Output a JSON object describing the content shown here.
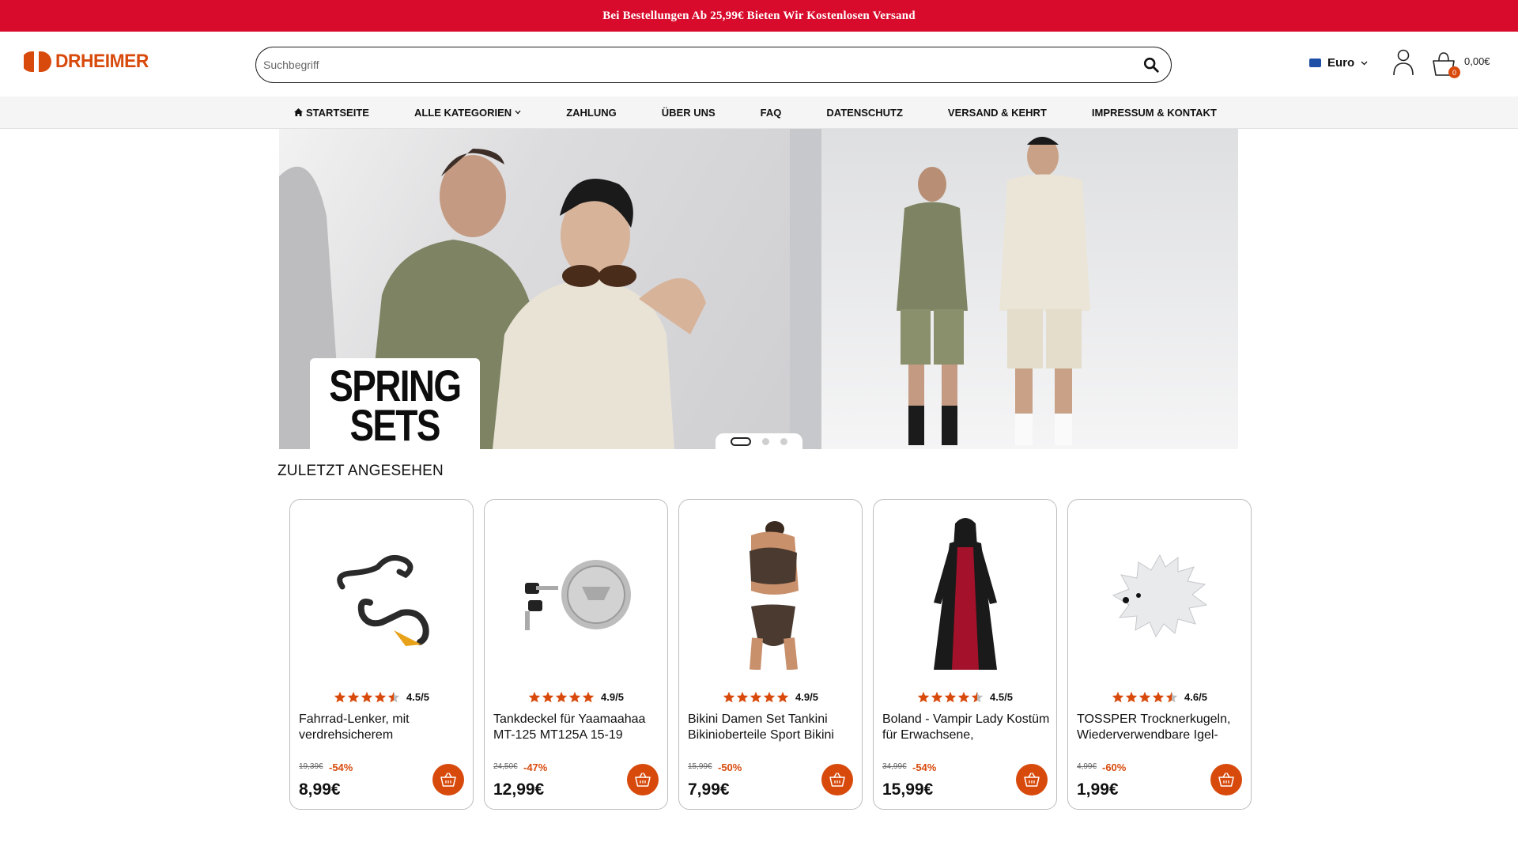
{
  "promo": {
    "text": "Bei Bestellungen Ab 25,99€ Bieten Wir Kostenlosen Versand"
  },
  "header": {
    "logo_text": "DRHEIMER",
    "search_placeholder": "Suchbegriff",
    "currency": "Euro",
    "cart_count": "0",
    "cart_total": "0,00€"
  },
  "nav": {
    "items": [
      {
        "label": "STARTSEITE",
        "icon": "home-icon"
      },
      {
        "label": "ALLE KATEGORIEN",
        "icon": "chevron-down-icon"
      },
      {
        "label": "ZAHLUNG"
      },
      {
        "label": "ÜBER UNS"
      },
      {
        "label": "FAQ"
      },
      {
        "label": "DATENSCHUTZ"
      },
      {
        "label": "VERSAND & KEHRT"
      },
      {
        "label": "IMPRESSUM & KONTAKT"
      }
    ]
  },
  "banner": {
    "line1": "SPRING",
    "line2": "SETS",
    "slides": 3,
    "active_slide": 1
  },
  "recent": {
    "title": "ZULETZT ANGESEHEN",
    "products": [
      {
        "rating": "4.5/5",
        "stars": 4.5,
        "name": "Fahrrad-Lenker, mit verdrehsicherem",
        "old_price": "19,39€",
        "discount": "-54%",
        "price": "8,99€",
        "image": "handlebar"
      },
      {
        "rating": "4.9/5",
        "stars": 5,
        "name": "Tankdeckel für Yaamaahaa MT-125 MT125A 15-19",
        "old_price": "24,50€",
        "discount": "-47%",
        "price": "12,99€",
        "image": "fuel-cap"
      },
      {
        "rating": "4.9/5",
        "stars": 5,
        "name": "Bikini Damen Set Tankini Bikinioberteile Sport Bikini",
        "old_price": "15,99€",
        "discount": "-50%",
        "price": "7,99€",
        "image": "bikini"
      },
      {
        "rating": "4.5/5",
        "stars": 4.5,
        "name": "Boland - Vampir Lady Kostüm für Erwachsene,",
        "old_price": "34,99€",
        "discount": "-54%",
        "price": "15,99€",
        "image": "costume"
      },
      {
        "rating": "4.6/5",
        "stars": 4.5,
        "name": "TOSSPER Trocknerkugeln, Wiederverwendbare Igel-",
        "old_price": "4,99€",
        "discount": "-60%",
        "price": "1,99€",
        "image": "dryer-ball"
      }
    ]
  },
  "colors": {
    "promo_bg": "#d80b2c",
    "accent": "#d84a0c",
    "star": "#d84a0c"
  }
}
